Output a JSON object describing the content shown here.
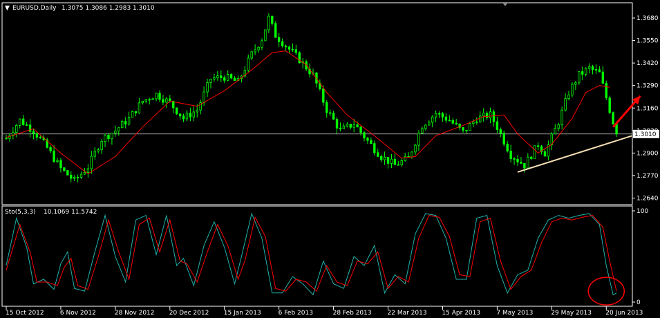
{
  "header": {
    "symbol": "EURUSD,Daily",
    "ohlc": "1.3075 1.3086 1.2983 1.3010"
  },
  "indicator": {
    "label": "Sto(5,3,3)",
    "values": "10.1069 11.5742"
  },
  "colors": {
    "background": "#000000",
    "frame": "#ffffff",
    "candles": "#00ff00",
    "ma": "#ff0000",
    "stoch_main": "#20b2aa",
    "stoch_signal": "#ff0000",
    "trendline": "#f5deb3",
    "arrow": "#ff0000"
  },
  "chart_data": [
    {
      "type": "candlestick",
      "title": "EURUSD,Daily",
      "current_price": 1.301,
      "current_price_label": "1.3010",
      "ylim": [
        1.261,
        1.376
      ],
      "y_ticks": [
        "1.3680",
        "1.3550",
        "1.3420",
        "1.3290",
        "1.3160",
        "1.3030",
        "1.2900",
        "1.2770",
        "1.2640"
      ],
      "y_tick_values": [
        1.368,
        1.355,
        1.342,
        1.329,
        1.316,
        1.303,
        1.29,
        1.277,
        1.264
      ],
      "x_ticks": [
        "15 Oct 2012",
        "6 Nov 2012",
        "28 Nov 2012",
        "20 Dec 2012",
        "15 Jan 2013",
        "6 Feb 2013",
        "28 Feb 2013",
        "22 Mar 2013",
        "15 Apr 2013",
        "7 May 2013",
        "29 May 2013",
        "20 Jun 2013"
      ],
      "x_tick_bar_index": [
        0,
        16,
        32,
        48,
        64,
        80,
        96,
        112,
        128,
        144,
        160,
        176
      ],
      "bars_total": 180,
      "close_path": [
        [
          0,
          1.2985
        ],
        [
          4,
          1.309
        ],
        [
          8,
          1.303
        ],
        [
          12,
          1.293
        ],
        [
          16,
          1.281
        ],
        [
          20,
          1.274
        ],
        [
          24,
          1.282
        ],
        [
          28,
          1.298
        ],
        [
          32,
          1.303
        ],
        [
          36,
          1.31
        ],
        [
          40,
          1.32
        ],
        [
          44,
          1.324
        ],
        [
          48,
          1.319
        ],
        [
          52,
          1.31
        ],
        [
          56,
          1.315
        ],
        [
          60,
          1.333
        ],
        [
          64,
          1.334
        ],
        [
          68,
          1.331
        ],
        [
          72,
          1.347
        ],
        [
          75,
          1.356
        ],
        [
          77,
          1.368
        ],
        [
          79,
          1.358
        ],
        [
          82,
          1.352
        ],
        [
          86,
          1.344
        ],
        [
          90,
          1.335
        ],
        [
          94,
          1.315
        ],
        [
          98,
          1.303
        ],
        [
          102,
          1.307
        ],
        [
          106,
          1.297
        ],
        [
          110,
          1.288
        ],
        [
          114,
          1.283
        ],
        [
          118,
          1.287
        ],
        [
          122,
          1.306
        ],
        [
          126,
          1.313
        ],
        [
          130,
          1.309
        ],
        [
          134,
          1.302
        ],
        [
          138,
          1.31
        ],
        [
          142,
          1.312
        ],
        [
          144,
          1.305
        ],
        [
          148,
          1.289
        ],
        [
          152,
          1.283
        ],
        [
          156,
          1.295
        ],
        [
          158,
          1.29
        ],
        [
          162,
          1.308
        ],
        [
          165,
          1.325
        ],
        [
          168,
          1.335
        ],
        [
          171,
          1.339
        ],
        [
          174,
          1.336
        ],
        [
          176,
          1.322
        ],
        [
          178,
          1.308
        ],
        [
          179,
          1.301
        ]
      ],
      "ma_series": {
        "name": "",
        "path": [
          [
            0,
            1.299
          ],
          [
            8,
            1.304
          ],
          [
            16,
            1.29
          ],
          [
            24,
            1.278
          ],
          [
            32,
            1.288
          ],
          [
            40,
            1.305
          ],
          [
            48,
            1.32
          ],
          [
            56,
            1.317
          ],
          [
            64,
            1.326
          ],
          [
            72,
            1.338
          ],
          [
            78,
            1.348
          ],
          [
            82,
            1.349
          ],
          [
            88,
            1.341
          ],
          [
            94,
            1.325
          ],
          [
            100,
            1.312
          ],
          [
            108,
            1.3
          ],
          [
            116,
            1.287
          ],
          [
            120,
            1.288
          ],
          [
            126,
            1.3
          ],
          [
            134,
            1.306
          ],
          [
            140,
            1.311
          ],
          [
            146,
            1.312
          ],
          [
            150,
            1.301
          ],
          [
            156,
            1.29
          ],
          [
            160,
            1.295
          ],
          [
            166,
            1.31
          ],
          [
            170,
            1.325
          ],
          [
            174,
            1.329
          ],
          [
            177,
            1.328
          ]
        ]
      },
      "trendline": [
        [
          150,
          1.279
        ],
        [
          230,
          1.329
        ]
      ],
      "arrow": {
        "from": [
          178,
          1.305
        ],
        "to": [
          186,
          1.323
        ]
      }
    },
    {
      "type": "line",
      "title": "Sto(5,3,3)",
      "ylim": [
        0,
        100
      ],
      "y_ticks": [
        "100",
        "0"
      ],
      "y_tick_values": [
        100,
        0
      ],
      "series": [
        {
          "name": "",
          "values": [
            [
              0,
              40
            ],
            [
              3,
              92
            ],
            [
              6,
              60
            ],
            [
              8,
              20
            ],
            [
              11,
              25
            ],
            [
              14,
              14
            ],
            [
              16,
              42
            ],
            [
              18,
              55
            ],
            [
              20,
              15
            ],
            [
              23,
              12
            ],
            [
              26,
              55
            ],
            [
              29,
              95
            ],
            [
              32,
              50
            ],
            [
              35,
              22
            ],
            [
              38,
              90
            ],
            [
              41,
              95
            ],
            [
              44,
              52
            ],
            [
              47,
              95
            ],
            [
              50,
              40
            ],
            [
              52,
              48
            ],
            [
              55,
              18
            ],
            [
              58,
              62
            ],
            [
              61,
              88
            ],
            [
              64,
              60
            ],
            [
              67,
              20
            ],
            [
              69,
              50
            ],
            [
              72,
              97
            ],
            [
              75,
              70
            ],
            [
              78,
              10
            ],
            [
              81,
              10
            ],
            [
              84,
              28
            ],
            [
              87,
              20
            ],
            [
              90,
              8
            ],
            [
              93,
              45
            ],
            [
              96,
              20
            ],
            [
              99,
              15
            ],
            [
              102,
              50
            ],
            [
              105,
              40
            ],
            [
              108,
              62
            ],
            [
              111,
              10
            ],
            [
              114,
              30
            ],
            [
              117,
              20
            ],
            [
              120,
              75
            ],
            [
              123,
              97
            ],
            [
              126,
              95
            ],
            [
              129,
              70
            ],
            [
              132,
              25
            ],
            [
              135,
              25
            ],
            [
              138,
              92
            ],
            [
              141,
              95
            ],
            [
              144,
              40
            ],
            [
              147,
              10
            ],
            [
              150,
              30
            ],
            [
              153,
              35
            ],
            [
              156,
              70
            ],
            [
              159,
              90
            ],
            [
              162,
              95
            ],
            [
              165,
              92
            ],
            [
              168,
              95
            ],
            [
              171,
              97
            ],
            [
              174,
              85
            ],
            [
              176,
              40
            ],
            [
              178,
              8
            ],
            [
              179,
              10
            ]
          ]
        },
        {
          "name": "",
          "values": [
            [
              0,
              35
            ],
            [
              4,
              85
            ],
            [
              7,
              55
            ],
            [
              9,
              22
            ],
            [
              12,
              22
            ],
            [
              15,
              18
            ],
            [
              17,
              38
            ],
            [
              19,
              48
            ],
            [
              21,
              18
            ],
            [
              24,
              14
            ],
            [
              27,
              50
            ],
            [
              30,
              90
            ],
            [
              33,
              55
            ],
            [
              36,
              25
            ],
            [
              39,
              85
            ],
            [
              42,
              92
            ],
            [
              45,
              55
            ],
            [
              48,
              90
            ],
            [
              51,
              45
            ],
            [
              53,
              42
            ],
            [
              56,
              22
            ],
            [
              59,
              55
            ],
            [
              62,
              85
            ],
            [
              65,
              62
            ],
            [
              68,
              25
            ],
            [
              70,
              45
            ],
            [
              73,
              93
            ],
            [
              76,
              72
            ],
            [
              79,
              15
            ],
            [
              82,
              12
            ],
            [
              85,
              25
            ],
            [
              88,
              22
            ],
            [
              91,
              12
            ],
            [
              94,
              40
            ],
            [
              97,
              22
            ],
            [
              100,
              18
            ],
            [
              103,
              45
            ],
            [
              106,
              42
            ],
            [
              109,
              55
            ],
            [
              112,
              15
            ],
            [
              115,
              28
            ],
            [
              118,
              22
            ],
            [
              121,
              70
            ],
            [
              124,
              95
            ],
            [
              127,
              93
            ],
            [
              130,
              72
            ],
            [
              133,
              30
            ],
            [
              136,
              28
            ],
            [
              139,
              88
            ],
            [
              142,
              92
            ],
            [
              145,
              45
            ],
            [
              148,
              14
            ],
            [
              151,
              28
            ],
            [
              154,
              35
            ],
            [
              157,
              65
            ],
            [
              160,
              88
            ],
            [
              163,
              92
            ],
            [
              166,
              90
            ],
            [
              169,
              93
            ],
            [
              172,
              95
            ],
            [
              175,
              82
            ],
            [
              177,
              45
            ],
            [
              179,
              12
            ]
          ]
        }
      ],
      "highlight_circle": [
        176,
        12
      ]
    }
  ]
}
